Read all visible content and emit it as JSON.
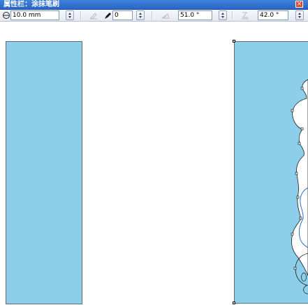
{
  "window": {
    "title": "属性栏：涂抹笔刷",
    "close_icon": "close-icon"
  },
  "toolbar": {
    "nib_size_icon": "nib-size-icon",
    "nib_size": "10.0 mm",
    "pen_pressure_icon": "pen-pressure-icon",
    "dryout_icon": "dryout-icon",
    "dryout": "0",
    "tilt_icon": "tilt-icon",
    "tilt": "51.0 °",
    "bearing_icon": "bearing-icon",
    "bearing": "42.0 °"
  },
  "canvas": {
    "fill_color": "#8dcfea",
    "outline_color": "#5f6a73",
    "objects": [
      "rectangle-left",
      "rectangle-right-smeared"
    ]
  }
}
